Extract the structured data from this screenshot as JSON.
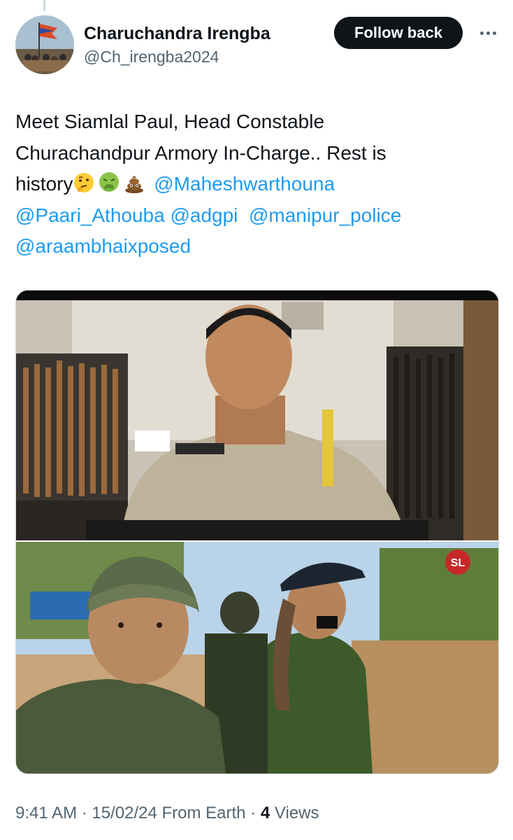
{
  "author": {
    "name": "Charuchandra Irengba",
    "handle": "@Ch_irengba2024",
    "avatar_icon": "avatar-photo-icon"
  },
  "actions": {
    "follow_label": "Follow back",
    "more_icon": "more-options-icon"
  },
  "tweet": {
    "line1": "Meet Siamlal Paul, Head Constable",
    "line2": "Churachandpur Armory In-Charge.. Rest is",
    "line3_text": "history",
    "emojis": [
      "thinking-face-icon",
      "nauseated-face-icon",
      "pile-of-poo-icon"
    ],
    "mentions": [
      "@Maheshwarthouna",
      "@Paari_Athouba",
      "@adgpi",
      "@manipur_police",
      "@araambhaixposed"
    ]
  },
  "media": {
    "photo_top": "armory-officer-photo",
    "photo_bottom": "field-selfie-photo",
    "watermark": "SL"
  },
  "meta": {
    "time": "9:41 AM",
    "date": "15/02/24",
    "source": "From Earth",
    "views_count": "4",
    "views_label": "Views"
  },
  "colors": {
    "text": "#0f1419",
    "secondary": "#536471",
    "link": "#1d9bf0",
    "button_bg": "#0f1419"
  }
}
